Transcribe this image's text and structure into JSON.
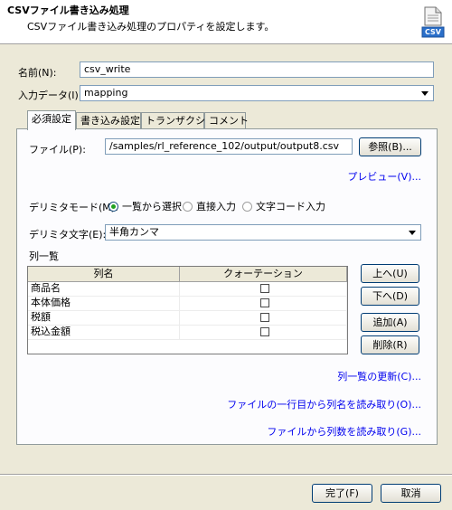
{
  "header": {
    "title": "CSVファイル書き込み処理",
    "description": "CSVファイル書き込み処理のプロパティを設定します。",
    "icon": "csv-file-icon",
    "icon_label": "CSV"
  },
  "fields": {
    "name_label": "名前(N):",
    "name_value": "csv_write",
    "input_label": "入力データ(I):",
    "input_value": "mapping"
  },
  "tabs": [
    {
      "label": "必須設定",
      "active": true
    },
    {
      "label": "書き込み設定",
      "active": false
    },
    {
      "label": "トランザクション",
      "active": false
    },
    {
      "label": "コメント",
      "active": false
    }
  ],
  "file": {
    "label": "ファイル(P):",
    "value": "/samples/rl_reference_102/output/output8.csv",
    "browse_label": "参照(B)...",
    "preview_label": "プレビュー(V)..."
  },
  "delimiter_mode": {
    "label": "デリミタモード(M):",
    "options": [
      "一覧から選択",
      "直接入力",
      "文字コード入力"
    ],
    "selected": "一覧から選択"
  },
  "delimiter_char": {
    "label": "デリミタ文字(E):",
    "value": "半角カンマ"
  },
  "columns": {
    "label": "列一覧",
    "headers": [
      "列名",
      "クォーテーション"
    ],
    "rows": [
      {
        "name": "商品名",
        "quoted": false
      },
      {
        "name": "本体価格",
        "quoted": false
      },
      {
        "name": "税額",
        "quoted": false
      },
      {
        "name": "税込金額",
        "quoted": false
      }
    ],
    "up_label": "上へ(U)",
    "down_label": "下へ(D)",
    "add_label": "追加(A)",
    "delete_label": "削除(R)"
  },
  "links": {
    "refresh": "列一覧の更新(C)...",
    "read_header": "ファイルの一行目から列名を読み取り(O)...",
    "read_count": "ファイルから列数を読み取り(G)..."
  },
  "footer": {
    "finish_label": "完了(F)",
    "cancel_label": "取消"
  }
}
